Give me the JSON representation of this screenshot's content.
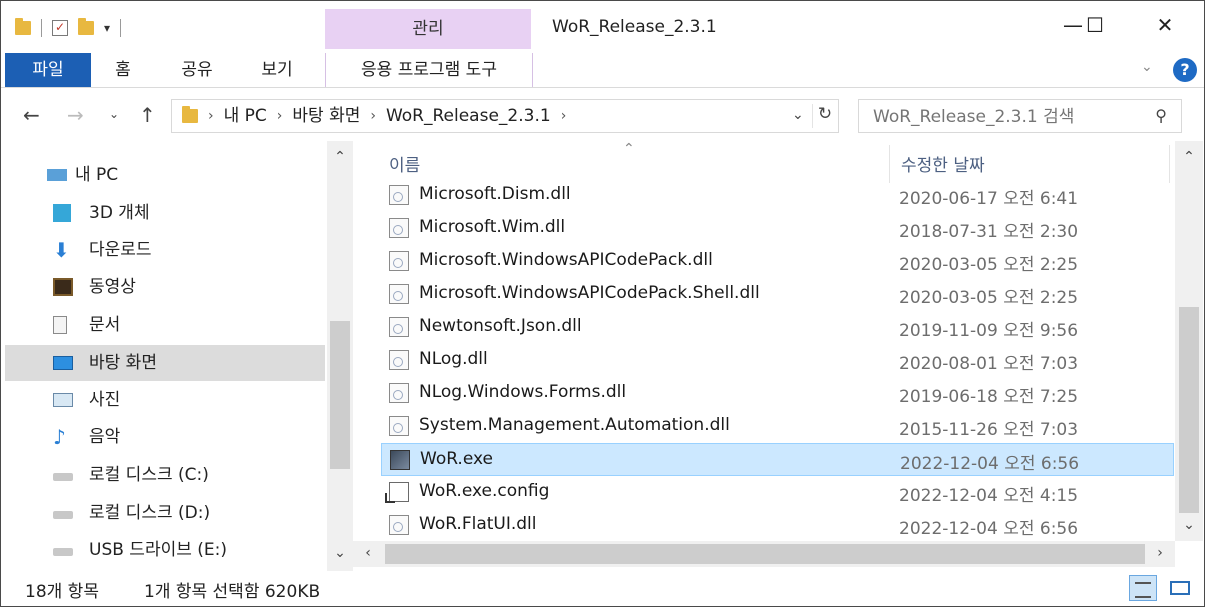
{
  "window": {
    "title": "WoR_Release_2.3.1",
    "context_tab": "관리",
    "minimize": "—",
    "maximize": "☐",
    "close": "✕"
  },
  "ribbon": {
    "tabs": [
      "파일",
      "홈",
      "공유",
      "보기",
      "응용 프로그램 도구"
    ],
    "file_color": "#1c5fb4",
    "context_color": "#e8d1f3",
    "help": "?"
  },
  "address": {
    "breadcrumbs": [
      "내 PC",
      "바탕 화면",
      "WoR_Release_2.3.1"
    ]
  },
  "search": {
    "placeholder": "WoR_Release_2.3.1 검색"
  },
  "nav": {
    "items": [
      {
        "label": "내 PC",
        "icon": "computer-icon"
      },
      {
        "label": "3D 개체",
        "icon": "3d-objects-icon"
      },
      {
        "label": "다운로드",
        "icon": "download-icon"
      },
      {
        "label": "동영상",
        "icon": "video-icon"
      },
      {
        "label": "문서",
        "icon": "document-icon"
      },
      {
        "label": "바탕 화면",
        "icon": "desktop-icon",
        "selected": true
      },
      {
        "label": "사진",
        "icon": "pictures-icon"
      },
      {
        "label": "음악",
        "icon": "music-icon"
      },
      {
        "label": "로컬 디스크 (C:)",
        "icon": "drive-c-icon"
      },
      {
        "label": "로컬 디스크 (D:)",
        "icon": "drive-d-icon"
      },
      {
        "label": "USB 드라이브 (E:)",
        "icon": "usb-drive-icon"
      }
    ]
  },
  "columns": {
    "name": "이름",
    "date": "수정한 날짜"
  },
  "files": [
    {
      "name": "Microsoft.Dism.dll",
      "date": "2020-06-17 오전 6:41",
      "type": "dll"
    },
    {
      "name": "Microsoft.Wim.dll",
      "date": "2018-07-31 오전 2:30",
      "type": "dll"
    },
    {
      "name": "Microsoft.WindowsAPICodePack.dll",
      "date": "2020-03-05 오전 2:25",
      "type": "dll"
    },
    {
      "name": "Microsoft.WindowsAPICodePack.Shell.dll",
      "date": "2020-03-05 오전 2:25",
      "type": "dll"
    },
    {
      "name": "Newtonsoft.Json.dll",
      "date": "2019-11-09 오전 9:56",
      "type": "dll"
    },
    {
      "name": "NLog.dll",
      "date": "2020-08-01 오전 7:03",
      "type": "dll"
    },
    {
      "name": "NLog.Windows.Forms.dll",
      "date": "2019-06-18 오전 7:25",
      "type": "dll"
    },
    {
      "name": "System.Management.Automation.dll",
      "date": "2015-11-26 오전 7:03",
      "type": "dll"
    },
    {
      "name": "WoR.exe",
      "date": "2022-12-04 오전 6:56",
      "type": "exe",
      "selected": true
    },
    {
      "name": "WoR.exe.config",
      "date": "2022-12-04 오전 4:15",
      "type": "config"
    },
    {
      "name": "WoR.FlatUI.dll",
      "date": "2022-12-04 오전 6:56",
      "type": "dll"
    }
  ],
  "status": {
    "item_count": "18개 항목",
    "selection": "1개 항목 선택함 620KB"
  },
  "colors": {
    "selection_bg": "#cce8ff",
    "selection_border": "#99d1ff",
    "header_text": "#4d6082"
  }
}
